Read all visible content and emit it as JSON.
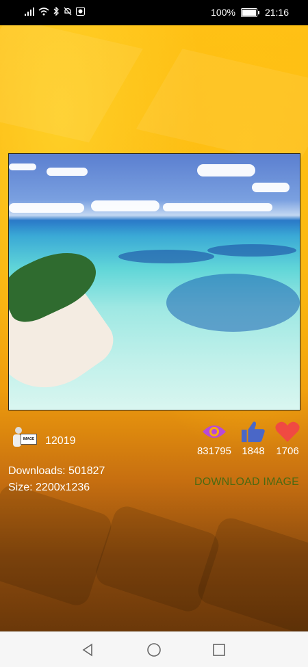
{
  "status_bar": {
    "battery_percent": "100%",
    "time": "21:16"
  },
  "image": {
    "author_id": "12019",
    "downloads_text": "Downloads: 501827",
    "size_text": "Size: 2200x1236",
    "views": "831795",
    "likes": "1848",
    "favorites": "1706"
  },
  "actions": {
    "download_label": "DOWNLOAD IMAGE"
  },
  "colors": {
    "views_icon": "#b84ad6",
    "likes_icon": "#4a67c7",
    "favorites_icon": "#f04a42",
    "download_text": "#4a6a12"
  },
  "icons": {
    "views": "eye-icon",
    "likes": "thumbs-up-icon",
    "favorites": "heart-icon",
    "nav_back": "back-triangle-icon",
    "nav_home": "home-circle-icon",
    "nav_recent": "recent-square-icon"
  }
}
